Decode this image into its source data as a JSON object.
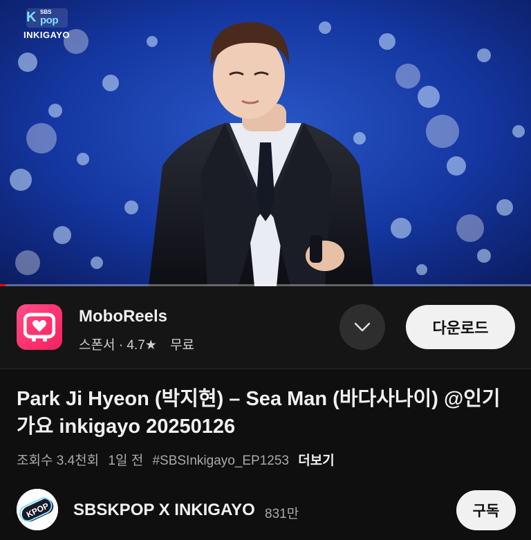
{
  "player": {
    "logo_top": "SBS",
    "logo_kpop": "pop",
    "logo_k": "K",
    "logo_bottom": "INKIGAYO",
    "progress": 0.01
  },
  "ad": {
    "app_name": "MoboReels",
    "sponsor_label": "스폰서",
    "separator": "·",
    "rating": "4.7★",
    "price": "무료",
    "download_label": "다운로드"
  },
  "video": {
    "title": "Park Ji Hyeon (박지현) – Sea Man (바다사나이) @인기가요 inkigayo 20250126",
    "views": "조회수 3.4천회",
    "age": "1일 전",
    "hashtag": "#SBSInkigayo_EP1253",
    "more_label": "더보기"
  },
  "channel": {
    "name": "SBSKPOP X INKIGAYO",
    "subscribers": "831만",
    "subscribe_label": "구독",
    "avatar_text": "KPOP"
  },
  "colors": {
    "background": "#0f0f0f",
    "ad_bar": "#151515",
    "progress": "#ff0000",
    "app_icon": "#ff2f6d"
  }
}
